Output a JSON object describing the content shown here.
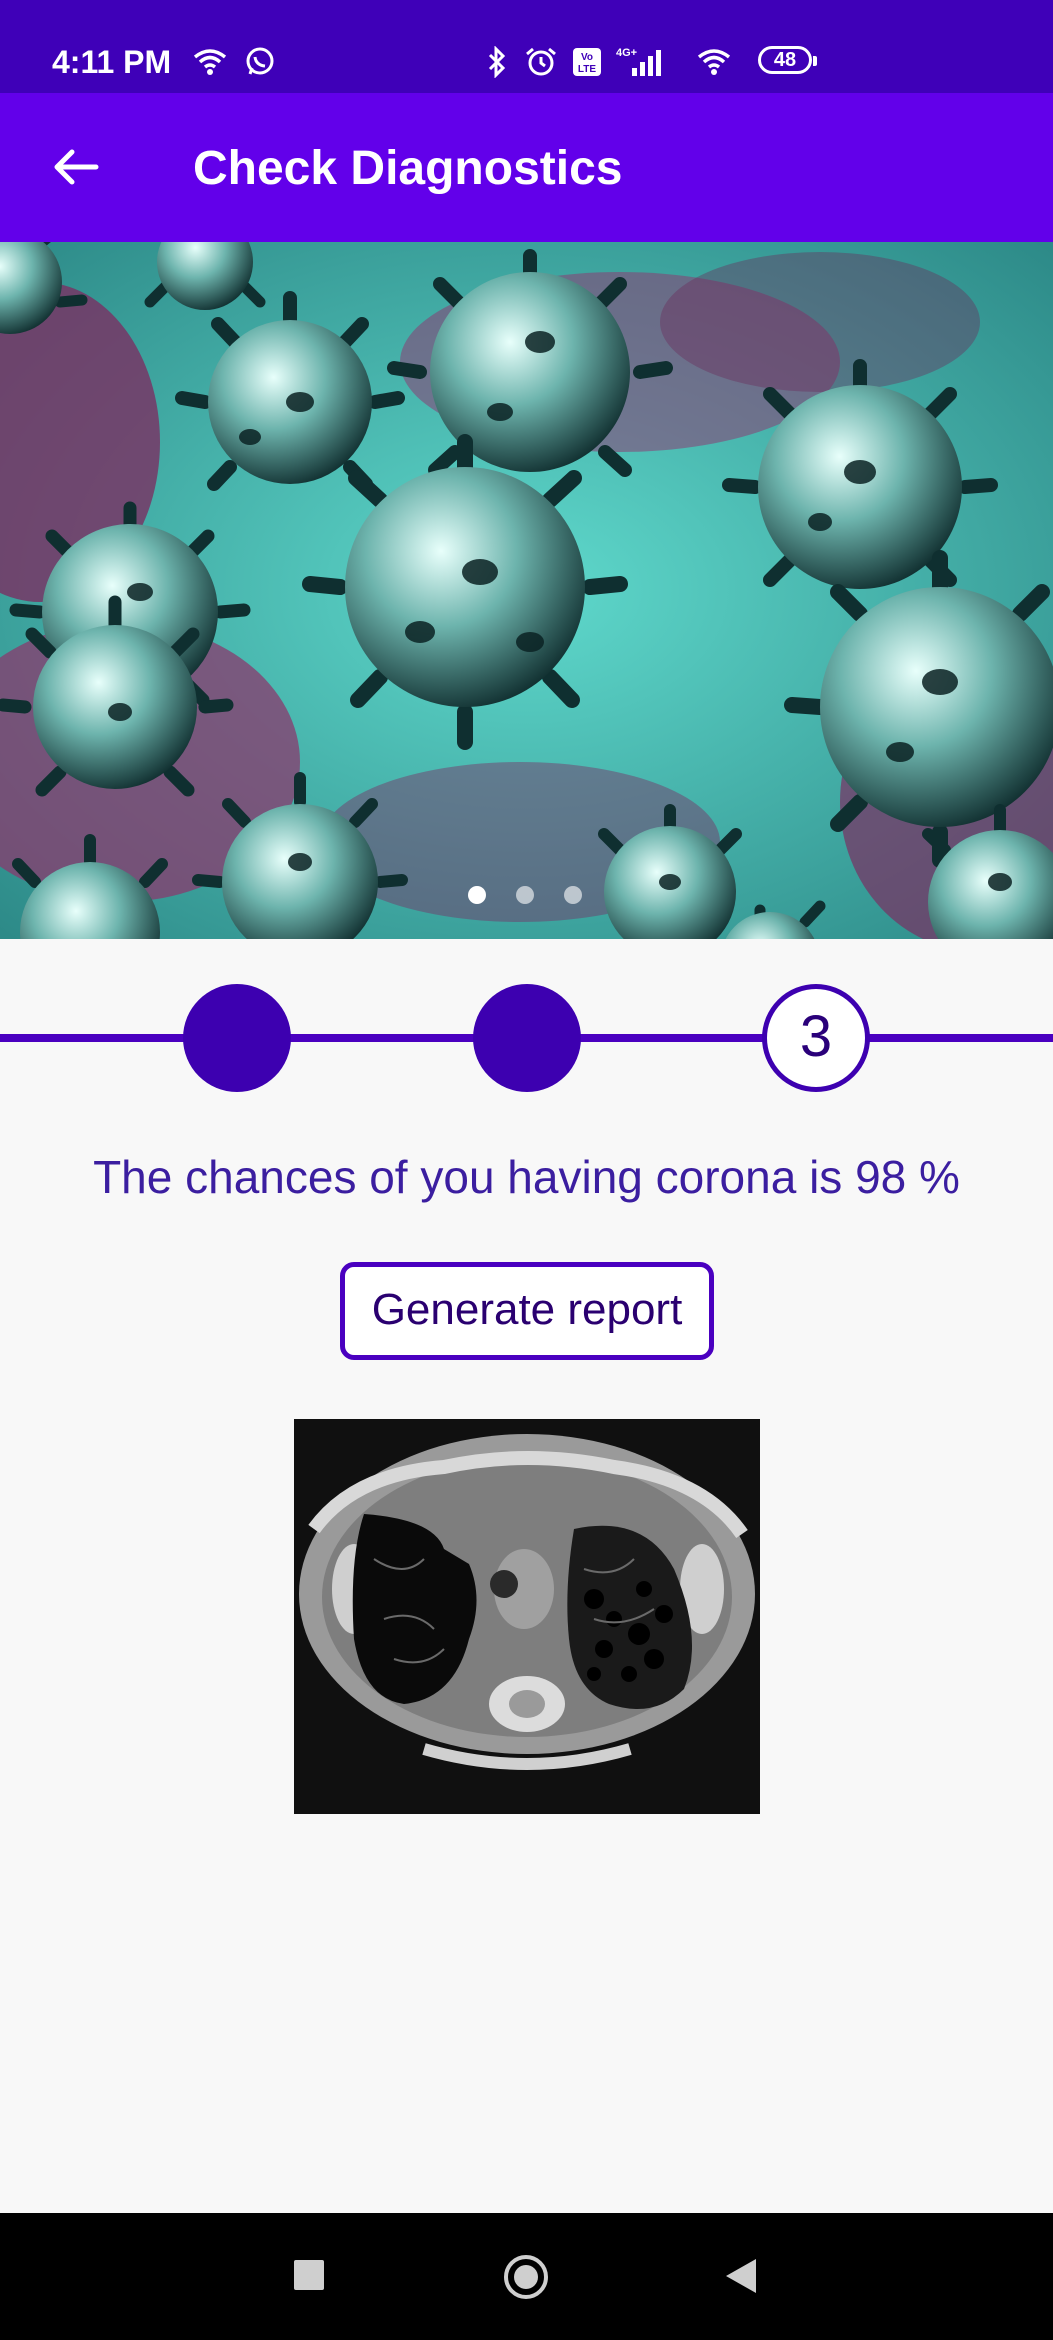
{
  "status_bar": {
    "time": "4:11 PM",
    "battery": "48",
    "icons": [
      "wifi-icon",
      "whatsapp-icon",
      "bluetooth-icon",
      "alarm-icon",
      "volte-icon",
      "signal-icon",
      "wifi-icon",
      "battery-icon"
    ]
  },
  "app_bar": {
    "title": "Check Diagnostics",
    "back_icon": "arrow-left-icon"
  },
  "banner": {
    "image": "coronavirus-illustration",
    "carousel_pages": 3,
    "active_page": 1
  },
  "stepper": {
    "steps": [
      {
        "state": "complete",
        "label": ""
      },
      {
        "state": "complete",
        "label": ""
      },
      {
        "state": "current",
        "label": "3"
      }
    ]
  },
  "result": {
    "text": "The chances of you having corona is  98 %"
  },
  "actions": {
    "generate_report": "Generate report"
  },
  "scan": {
    "image": "chest-ct-scan"
  },
  "nav_bar": {
    "icons": [
      "recents-square-icon",
      "home-circle-icon",
      "back-triangle-icon"
    ]
  },
  "colors": {
    "status_bar": "#3f00b8",
    "app_bar": "#6200ea",
    "accent": "#3d00b0",
    "text_accent": "#3b1ea0"
  }
}
